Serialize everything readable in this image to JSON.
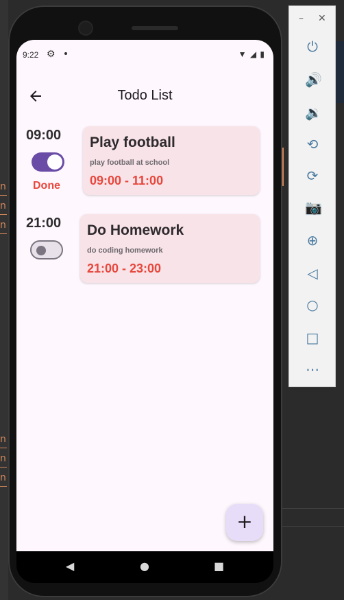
{
  "status_bar": {
    "time": "9:22",
    "icons": [
      "gear-icon",
      "dot-icon",
      "wifi-icon",
      "signal-icon",
      "battery-icon"
    ]
  },
  "app_bar": {
    "title": "Todo List",
    "back_icon": "arrow-left-icon"
  },
  "todos": [
    {
      "time": "09:00",
      "done": true,
      "done_label": "Done",
      "title": "Play football",
      "description": "play football at school",
      "range": "09:00 - 11:00"
    },
    {
      "time": "21:00",
      "done": false,
      "done_label": "",
      "title": "Do Homework",
      "description": "do coding homework",
      "range": "21:00 - 23:00"
    }
  ],
  "fab": {
    "label": "+"
  },
  "colors": {
    "accent": "#6a4ca6",
    "done_red": "#e8473c",
    "card_bg": "#f8e3e8",
    "screen_bg": "#fef7fd",
    "fab_bg": "#e8ddf8"
  },
  "emulator_toolbar": {
    "window_controls": [
      "minimize-icon",
      "close-icon"
    ],
    "buttons": [
      "power-icon",
      "volume-up-icon",
      "volume-down-icon",
      "rotate-left-icon",
      "rotate-right-icon",
      "camera-icon",
      "zoom-icon",
      "back-icon",
      "home-icon",
      "overview-icon",
      "more-icon"
    ]
  },
  "nav_bar": [
    "back-triangle-icon",
    "home-circle-icon",
    "recents-square-icon"
  ]
}
